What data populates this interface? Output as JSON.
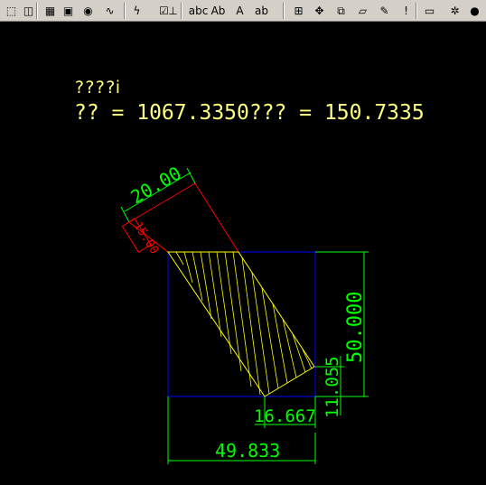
{
  "toolbar": {
    "buttons": [
      {
        "name": "select-icon",
        "glyph": "⬚"
      },
      {
        "name": "layers-icon",
        "glyph": "◫"
      },
      {
        "name": "color-palette-icon",
        "glyph": "▦"
      },
      {
        "name": "image-icon",
        "glyph": "▣"
      },
      {
        "name": "globe-icon",
        "glyph": "◉"
      },
      {
        "name": "waveform-icon",
        "glyph": "∿"
      },
      {
        "name": "lightning-icon",
        "glyph": "ϟ"
      },
      {
        "name": "checkbox-icon",
        "glyph": "☑"
      },
      {
        "name": "ruler-icon",
        "glyph": "⊥"
      },
      {
        "name": "text-abc-icon",
        "glyph": "abc"
      },
      {
        "name": "text-style-icon",
        "glyph": "Ab"
      },
      {
        "name": "text-abcd-icon",
        "glyph": "A"
      },
      {
        "name": "text-edit-icon",
        "glyph": "ab"
      },
      {
        "name": "grid-icon",
        "glyph": "⊞"
      },
      {
        "name": "move-icon",
        "glyph": "✥"
      },
      {
        "name": "layer-properties-icon",
        "glyph": "⧉"
      },
      {
        "name": "plane-icon",
        "glyph": "▱"
      },
      {
        "name": "match-properties-icon",
        "glyph": "✎"
      },
      {
        "name": "alert-icon",
        "glyph": "!"
      },
      {
        "name": "window-icon",
        "glyph": "▭"
      },
      {
        "name": "settings-icon",
        "glyph": "✲"
      },
      {
        "name": "lightbulb-icon",
        "glyph": "●"
      },
      {
        "name": "lock-icon",
        "glyph": "🔒"
      }
    ]
  },
  "drawing": {
    "text_line1": "????ⅰ",
    "text_line2": "?? = 1067.3350??? = 150.7335",
    "dims": {
      "width_top": "20.00",
      "side_red": "15.00",
      "height_right": "50.000",
      "small_right": "11.055",
      "bottom_small": "16.667",
      "bottom_total": "49.833"
    },
    "colors": {
      "text_yellow": "#ffff80",
      "dim_green": "#00ff00",
      "red": "#ff0000",
      "blue": "#0000ff",
      "hatch": "#ffff00",
      "white": "#ffffff"
    }
  }
}
